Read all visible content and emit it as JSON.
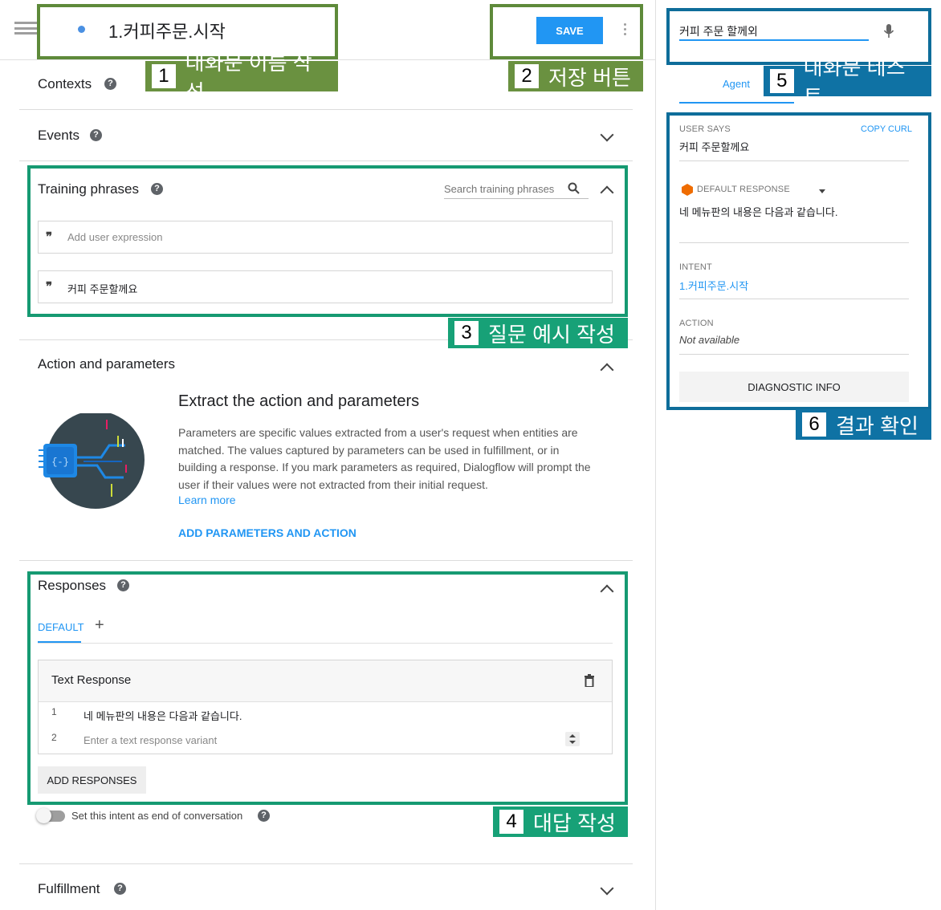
{
  "header": {
    "intent_name": "1.커피주문.시작",
    "save_label": "SAVE"
  },
  "sections": {
    "contexts": "Contexts",
    "events": "Events",
    "training_phrases": "Training phrases",
    "action_and_parameters": "Action and parameters",
    "responses": "Responses",
    "fulfillment": "Fulfillment",
    "help_glyph": "?"
  },
  "training": {
    "search_placeholder": "Search training phrases",
    "add_placeholder": "Add user expression",
    "phrases": [
      "커피 주문할께요"
    ]
  },
  "action_params": {
    "heading": "Extract the action and parameters",
    "description": "Parameters are specific values extracted from a user's request when entities are matched. The values captured by parameters can be used in fulfillment, or in building a response. If you mark parameters as required, Dialogflow will prompt the user if their values were not extracted from their initial request.",
    "learn_more": "Learn more",
    "add_button": "ADD PARAMETERS AND ACTION"
  },
  "responses": {
    "tab_default": "DEFAULT",
    "tab_add": "+",
    "card_title": "Text Response",
    "rows": [
      {
        "num": "1",
        "text": "네 메뉴판의 내용은 다음과 같습니다."
      },
      {
        "num": "2",
        "placeholder": "Enter a text response variant"
      }
    ],
    "add_responses": "ADD RESPONSES",
    "end_conversation": "Set this intent as end of conversation"
  },
  "test_panel": {
    "input_value": "커피 주문 할께외",
    "tab_agent": "Agent",
    "user_says_label": "USER SAYS",
    "copy_curl": "COPY CURL",
    "user_says_value": "커피 주문할께요",
    "default_response_label": "DEFAULT RESPONSE",
    "default_response_value": "네 메뉴판의 내용은 다음과 같습니다.",
    "intent_label": "INTENT",
    "intent_value": "1.커피주문.시작",
    "action_label": "ACTION",
    "action_value": "Not available",
    "diagnostic": "DIAGNOSTIC INFO"
  },
  "callouts": [
    {
      "num": "1",
      "text": "대화문 이름 작성"
    },
    {
      "num": "2",
      "text": "저장 버튼"
    },
    {
      "num": "3",
      "text": "질문 예시 작성"
    },
    {
      "num": "4",
      "text": "대답 작성"
    },
    {
      "num": "5",
      "text": "대화문 테스트"
    },
    {
      "num": "6",
      "text": "결과 확인"
    }
  ],
  "colors": {
    "accent": "#2196f3",
    "callout_olive": "#6a9140",
    "callout_teal": "#17a177",
    "callout_blue": "#0f72a4"
  }
}
